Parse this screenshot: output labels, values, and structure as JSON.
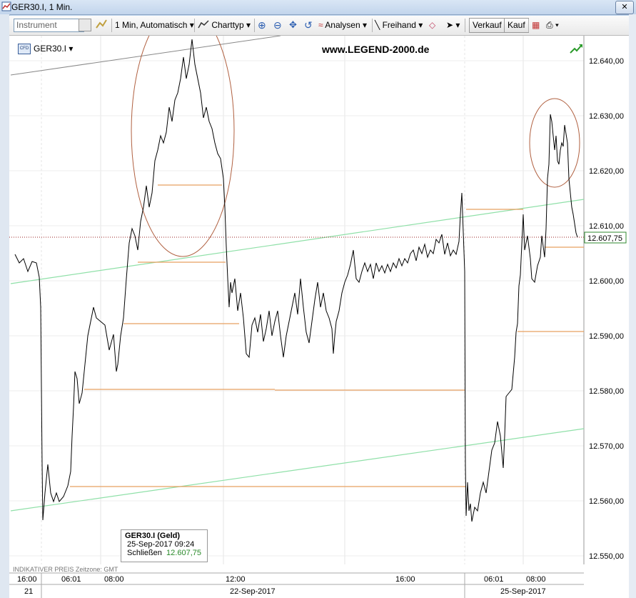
{
  "window": {
    "title": "GER30.I, 1 Min."
  },
  "toolbar": {
    "instrument_placeholder": "Instrument",
    "interval": "1 Min,  Automatisch",
    "charttyp": "Charttyp",
    "analysen": "Analysen",
    "freihand": "Freihand",
    "verkauf": "Verkauf",
    "kauf": "Kauf"
  },
  "chart_header": {
    "symbol": "GER30.I",
    "symbol_badge": "CFD",
    "watermark": "www.LEGEND-2000.de"
  },
  "price_axis": {
    "ticks": [
      "12.640,00",
      "12.630,00",
      "12.620,00",
      "12.610,00",
      "12.600,00",
      "12.590,00",
      "12.580,00",
      "12.570,00",
      "12.560,00",
      "12.550,00"
    ],
    "current_price": "12.607,75"
  },
  "time_axis": {
    "times": [
      "16:00",
      "06:01",
      "08:00",
      "12:00",
      "16:00",
      "06:01",
      "08:00"
    ],
    "dates": [
      "21",
      "22-Sep-2017",
      "25-Sep-2017"
    ]
  },
  "info_box": {
    "title": "GER30.I (Geld)",
    "datetime": "25-Sep-2017 09:24",
    "label": "Schließen",
    "value": "12.607,75"
  },
  "footer": {
    "note": "INDIKATIVER PREIS   Zeitzone: GMT"
  },
  "colors": {
    "level_lines": "#e8a060",
    "trend_lines": "#8fe0a8",
    "circles": "#b06040",
    "price_line": "#000000",
    "current_price_line": "#9a2020"
  }
}
